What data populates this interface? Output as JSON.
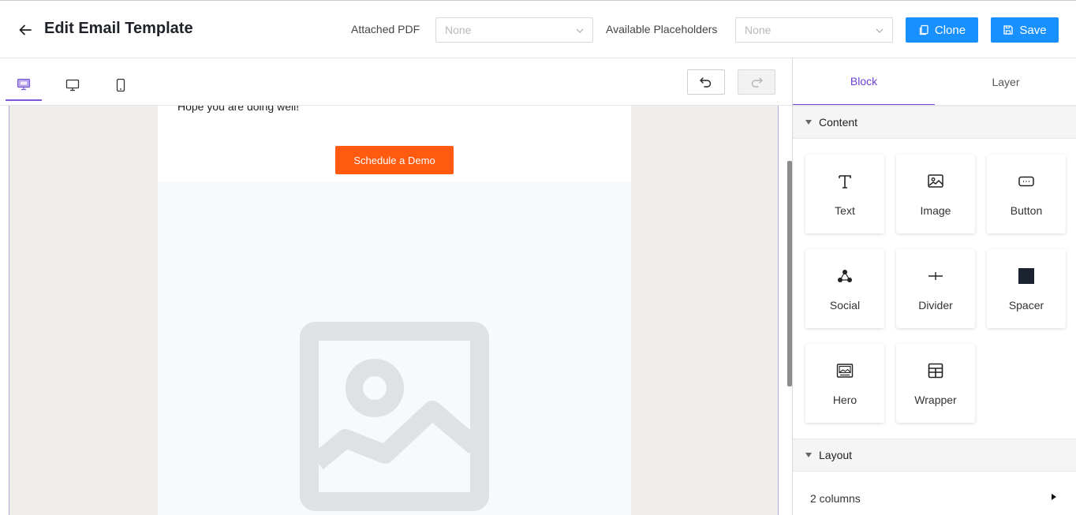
{
  "header": {
    "title": "Edit Email Template",
    "attached_pdf_label": "Attached PDF",
    "attached_pdf_value": "None",
    "placeholders_label": "Available Placeholders",
    "placeholders_value": "None",
    "clone_label": "Clone",
    "save_label": "Save"
  },
  "toolbar": {
    "tabs": [
      "desktop-edit-icon",
      "desktop-icon",
      "mobile-icon"
    ],
    "active_tab": 0
  },
  "email": {
    "greeting": "Hope you are doing well!",
    "cta_label": "Schedule a Demo",
    "cta_color": "#ff5a0f"
  },
  "panel": {
    "tabs": [
      "Block",
      "Layer"
    ],
    "active_tab": "Block",
    "content_section": "Content",
    "blocks": [
      {
        "label": "Text",
        "icon": "text-icon"
      },
      {
        "label": "Image",
        "icon": "image-icon"
      },
      {
        "label": "Button",
        "icon": "button-icon"
      },
      {
        "label": "Social",
        "icon": "social-icon"
      },
      {
        "label": "Divider",
        "icon": "divider-icon"
      },
      {
        "label": "Spacer",
        "icon": "spacer-icon"
      },
      {
        "label": "Hero",
        "icon": "hero-icon"
      },
      {
        "label": "Wrapper",
        "icon": "wrapper-icon"
      }
    ],
    "layout_section": "Layout",
    "layout_item": "2 columns",
    "accent_color": "#6d3fd6"
  }
}
